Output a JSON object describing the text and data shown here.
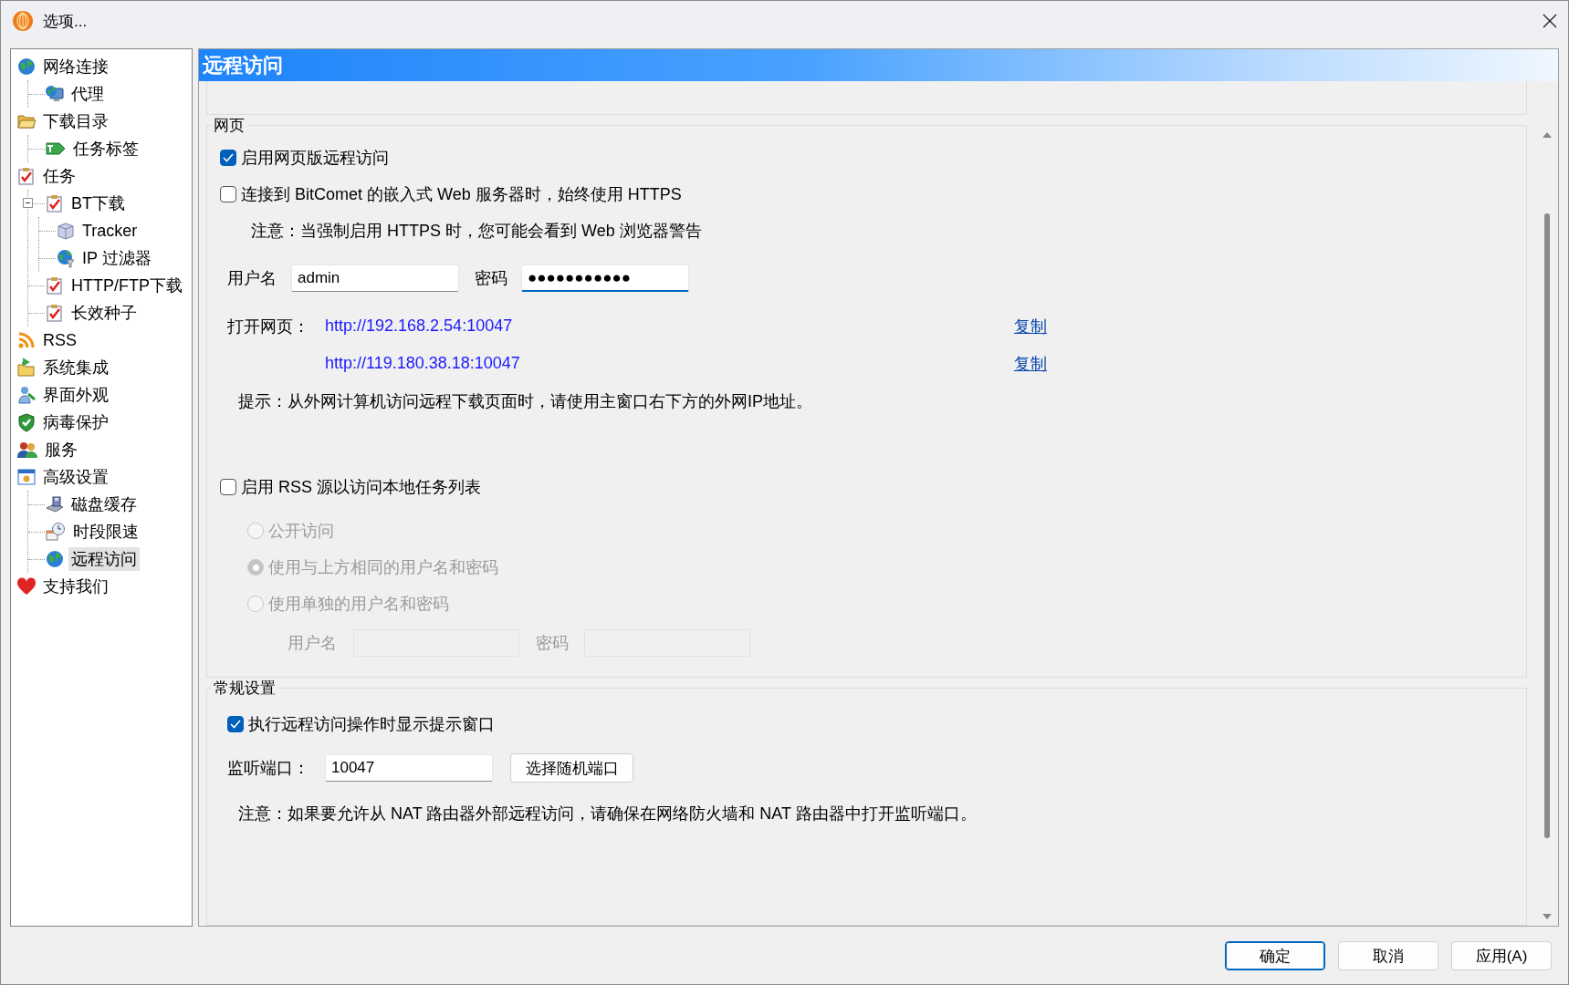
{
  "window": {
    "title": "选项..."
  },
  "sidebar": {
    "items": [
      {
        "label": "网络连接",
        "selected": false,
        "children": [
          {
            "label": "代理",
            "selected": false
          }
        ]
      },
      {
        "label": "下载目录",
        "selected": false,
        "children": [
          {
            "label": "任务标签",
            "selected": false
          }
        ]
      },
      {
        "label": "任务",
        "selected": false,
        "children": [
          {
            "label": "BT下载",
            "selected": false,
            "expanded": true,
            "children": [
              {
                "label": "Tracker",
                "selected": false
              },
              {
                "label": "IP 过滤器",
                "selected": false
              }
            ]
          },
          {
            "label": "HTTP/FTP下载",
            "selected": false
          },
          {
            "label": "长效种子",
            "selected": false
          }
        ]
      },
      {
        "label": "RSS",
        "selected": false
      },
      {
        "label": "系统集成",
        "selected": false
      },
      {
        "label": "界面外观",
        "selected": false
      },
      {
        "label": "病毒保护",
        "selected": false
      },
      {
        "label": "服务",
        "selected": false
      },
      {
        "label": "高级设置",
        "selected": false,
        "children": [
          {
            "label": "磁盘缓存",
            "selected": false
          },
          {
            "label": "时段限速",
            "selected": false
          },
          {
            "label": "远程访问",
            "selected": true
          }
        ]
      },
      {
        "label": "支持我们",
        "selected": false
      }
    ]
  },
  "page": {
    "title": "远程访问",
    "web_group": {
      "title": "网页",
      "options": [
        {
          "label": "启用网页版远程访问",
          "checked": true
        },
        {
          "label": "连接到 BitComet 的嵌入式 Web 服务器时，始终使用 HTTPS",
          "checked": false
        }
      ],
      "note": "注意：当强制启用 HTTPS 时，您可能会看到 Web 浏览器警告",
      "username": {
        "label": "用户名",
        "value": "admin",
        "focused": false
      },
      "password": {
        "label": "密码",
        "value": "●●●●●●●●●●●",
        "focused": true
      },
      "open_label": "打开网页：",
      "links": [
        {
          "url": "http://192.168.2.54:10047",
          "copy": "复制"
        },
        {
          "url": "http://119.180.38.18:10047",
          "copy": "复制"
        }
      ],
      "hint": "提示：从外网计算机访问远程下载页面时，请使用主窗口右下方的外网IP地址。",
      "rss": {
        "label": "启用 RSS 源以访问本地任务列表",
        "checked": false
      },
      "access_modes": [
        {
          "label": "公开访问",
          "selected": false
        },
        {
          "label": "使用与上方相同的用户名和密码",
          "selected": true
        },
        {
          "label": "使用单独的用户名和密码",
          "selected": false
        }
      ],
      "rss_username": {
        "label": "用户名"
      },
      "rss_password": {
        "label": "密码"
      }
    },
    "general_group": {
      "title": "常规设置",
      "option": {
        "label": "执行远程访问操作时显示提示窗口",
        "checked": true
      },
      "port": {
        "label": "监听端口：",
        "value": "10047",
        "button": "选择随机端口"
      },
      "note": "注意：如果要允许从 NAT 路由器外部远程访问，请确保在网络防火墙和 NAT 路由器中打开监听端口。"
    }
  },
  "buttons": [
    {
      "label": "确定",
      "default": true
    },
    {
      "label": "取消",
      "default": false
    },
    {
      "label": "应用(A)",
      "default": false
    }
  ]
}
